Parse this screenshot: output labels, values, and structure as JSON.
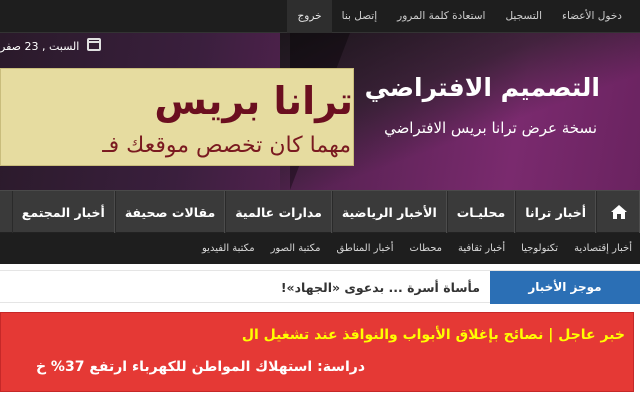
{
  "top_links": [
    "دخول الأعضاء",
    "التسجيل",
    "استعادة كلمة المرور",
    "إتصل بنا",
    "خروج"
  ],
  "header": {
    "date": "السبت , 23 صفر",
    "site_title": "التصميم الافتراضي",
    "site_subtitle": "نسخة عرض ترانا بريس الافتراضي",
    "banner_title": "ترانا بريس",
    "banner_subtitle": "مهما كان تخصص موقعك فـ"
  },
  "main_nav": [
    "أخبار ترانا",
    "محليـات",
    "الأخبار الرياضية",
    "مدارات عالمية",
    "مقالات صحيفة",
    "أخبار المجتمع"
  ],
  "sub_nav": [
    "أخبار إقتصادية",
    "تكنولوجيا",
    "أخبار ثقافية",
    "محطات",
    "أخبار المناطق",
    "مكتبة الصور",
    "مكتبة الفيديو"
  ],
  "ticker": {
    "label": "موجز الأخبار",
    "text": "مأساة أسرة ... بدعوى «الجهاد»!"
  },
  "breaking": {
    "label": "خبر عاجل |",
    "headline1": "نصائح بإغلاق الأبواب والنوافذ عند تشغيل ال",
    "headline2": "دراسة: استهلاك المواطن للكهرباء ارتفع 37% خ"
  },
  "colors": {
    "accent_blue": "#2b6fb5",
    "breaking_red": "#e53935",
    "breaking_yellow": "#ffff00",
    "banner_bg": "#e6dca0",
    "banner_text": "#6b0f1f"
  },
  "icons": {
    "home": "home-icon",
    "calendar": "calendar-icon"
  }
}
